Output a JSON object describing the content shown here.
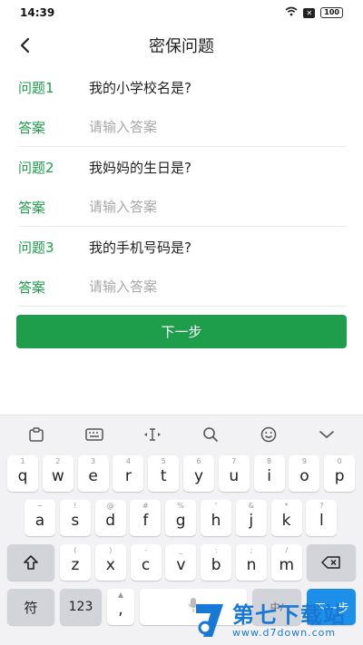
{
  "status": {
    "time": "14:39",
    "battery": "100"
  },
  "nav": {
    "title": "密保问题"
  },
  "form": {
    "rows": [
      {
        "q_label": "问题1",
        "question": "我的小学校名是?",
        "a_label": "答案",
        "placeholder": "请输入答案"
      },
      {
        "q_label": "问题2",
        "question": "我妈妈的生日是?",
        "a_label": "答案",
        "placeholder": "请输入答案"
      },
      {
        "q_label": "问题3",
        "question": "我的手机号码是?",
        "a_label": "答案",
        "placeholder": "请输入答案"
      }
    ]
  },
  "next_button": {
    "label": "下一步"
  },
  "keyboard": {
    "row1": [
      {
        "k": "q",
        "s": "1"
      },
      {
        "k": "w",
        "s": "2"
      },
      {
        "k": "e",
        "s": "3"
      },
      {
        "k": "r",
        "s": "4"
      },
      {
        "k": "t",
        "s": "5"
      },
      {
        "k": "y",
        "s": "6"
      },
      {
        "k": "u",
        "s": "7"
      },
      {
        "k": "i",
        "s": "8"
      },
      {
        "k": "o",
        "s": "9"
      },
      {
        "k": "p",
        "s": "0"
      }
    ],
    "row2": [
      {
        "k": "a",
        "s": "~"
      },
      {
        "k": "s",
        "s": "!"
      },
      {
        "k": "d",
        "s": "@"
      },
      {
        "k": "f",
        "s": "#"
      },
      {
        "k": "g",
        "s": "%"
      },
      {
        "k": "h",
        "s": "'"
      },
      {
        "k": "j",
        "s": "&"
      },
      {
        "k": "k",
        "s": "*"
      },
      {
        "k": "l",
        "s": "?"
      }
    ],
    "row3": [
      {
        "k": "z",
        "s": "("
      },
      {
        "k": "x",
        "s": ")"
      },
      {
        "k": "c",
        "s": "-"
      },
      {
        "k": "v",
        "s": "_"
      },
      {
        "k": "b",
        "s": ":"
      },
      {
        "k": "n",
        "s": ";"
      },
      {
        "k": "m",
        "s": "/"
      }
    ],
    "symbol_key": "符",
    "num_key": "123",
    "comma_key": ",",
    "lang_key": "中/",
    "enter_key": "下一步"
  },
  "watermark": {
    "cn": "第七下载站",
    "url": "www.d7down.com"
  },
  "colors": {
    "accent": "#1e9e4b",
    "label_green": "#1f9d4c",
    "enter_blue": "#1d8fe8"
  }
}
